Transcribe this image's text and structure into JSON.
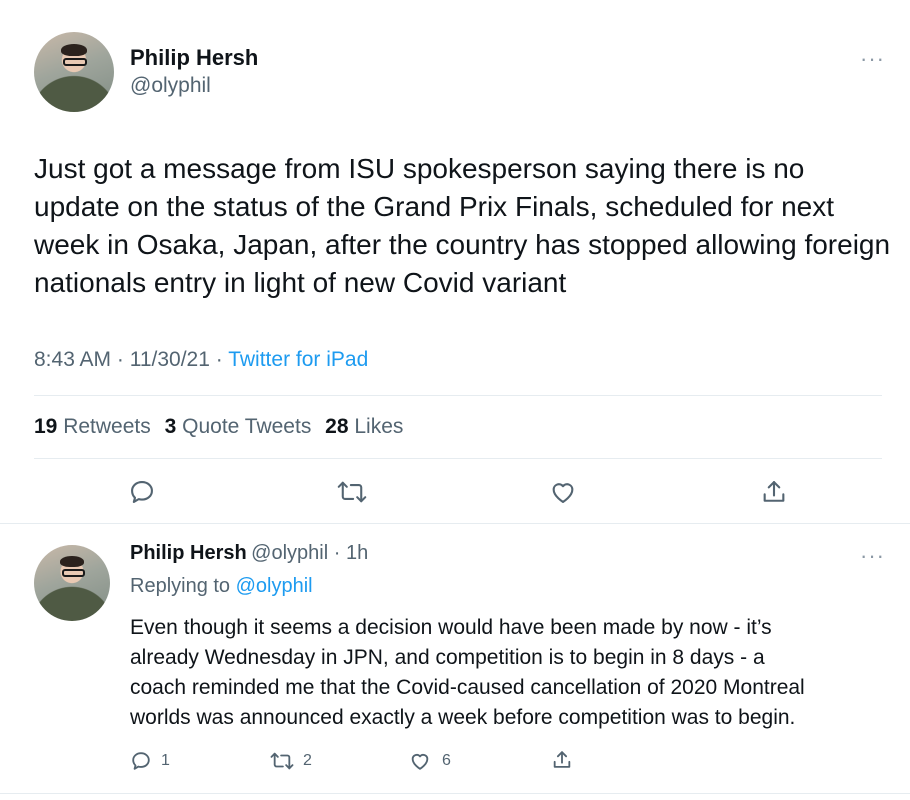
{
  "tweet": {
    "author_name": "Philip Hersh",
    "author_handle": "@olyphil",
    "more": "···",
    "text": "Just got a message from ISU spokesperson saying there is no update on the status of the Grand Prix Finals, scheduled for next week in Osaka, Japan, after the country has stopped allowing foreign nationals entry in light of new Covid variant",
    "time": "8:43 AM",
    "date": "11/30/21",
    "source": "Twitter for iPad",
    "stats": {
      "retweets_count": "19",
      "retweets_label": "Retweets",
      "quotes_count": "3",
      "quotes_label": "Quote Tweets",
      "likes_count": "28",
      "likes_label": "Likes"
    },
    "icons": [
      "reply-icon",
      "retweet-icon",
      "like-icon",
      "share-icon"
    ]
  },
  "reply": {
    "author_name": "Philip Hersh",
    "author_handle": "@olyphil",
    "age": "1h",
    "more": "···",
    "replying_to_label": "Replying to",
    "replying_to_handle": "@olyphil",
    "text_lines": [
      "Even though it seems a decision would have been made by now - it’s",
      "already Wednesday in JPN, and competition is to begin in 8 days  - a",
      "coach reminded me that the Covid-caused cancellation of 2020 Montreal",
      "worlds was announced exactly a week before competition was to begin."
    ],
    "reply_count": "1",
    "retweet_count": "2",
    "like_count": "6"
  },
  "colors": {
    "accent": "#1d9bf0",
    "text": "#0f1419",
    "secondary": "#536471",
    "divider": "#e6ecf0"
  }
}
